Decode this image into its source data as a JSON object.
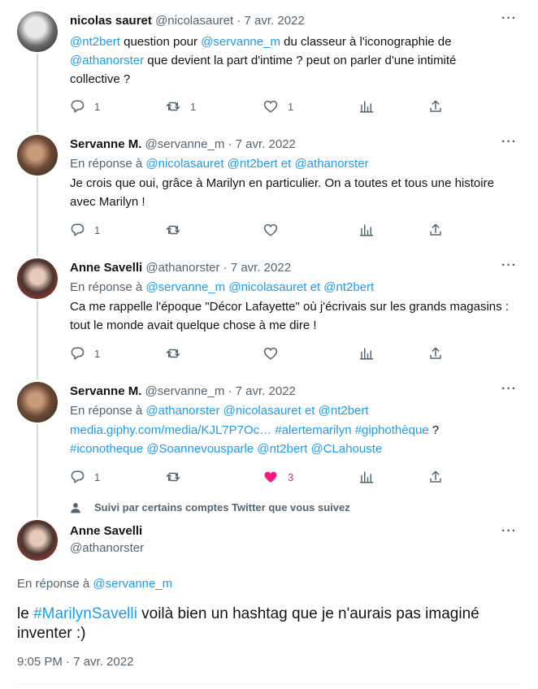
{
  "tweets": [
    {
      "name": "nicolas sauret",
      "handle": "@nicolasauret",
      "sep": "·",
      "date": "7 avr. 2022",
      "reply_prefix": "",
      "reply_handles": "",
      "text_parts": [
        {
          "t": "@nt2bert",
          "link": true
        },
        {
          "t": " question pour ",
          "link": false
        },
        {
          "t": "@servanne_m",
          "link": true
        },
        {
          "t": " du classeur à l'iconographie de ",
          "link": false
        },
        {
          "t": "@athanorster",
          "link": true
        },
        {
          "t": " que devient la part d'intime ? peut on parler d'une intimité collective ?",
          "link": false
        }
      ],
      "replies": "1",
      "retweets": "1",
      "likes": "1"
    },
    {
      "name": "Servanne M.",
      "handle": "@servanne_m",
      "sep": "·",
      "date": "7 avr. 2022",
      "reply_prefix": "En réponse à",
      "reply_handles": "@nicolasauret @nt2bert  et  @athanorster",
      "text_parts": [
        {
          "t": "Je crois que oui, grâce à Marilyn en particulier. On a toutes et tous une histoire avec Marilyn !",
          "link": false
        }
      ],
      "replies": "1",
      "retweets": "",
      "likes": ""
    },
    {
      "name": "Anne Savelli",
      "handle": "@athanorster",
      "sep": "·",
      "date": "7 avr. 2022",
      "reply_prefix": "En réponse à",
      "reply_handles": "@servanne_m @nicolasauret  et  @nt2bert",
      "text_parts": [
        {
          "t": "Ca me rappelle l'époque \"Décor Lafayette\" où j'écrivais sur les grands magasins : tout le monde avait quelque chose à me dire !",
          "link": false
        }
      ],
      "replies": "1",
      "retweets": "",
      "likes": ""
    },
    {
      "name": "Servanne M.",
      "handle": "@servanne_m",
      "sep": "·",
      "date": "7 avr. 2022",
      "reply_prefix": "En réponse à",
      "reply_handles": "@athanorster @nicolasauret  et  @nt2bert",
      "text_parts": [
        {
          "t": "media.giphy.com/media/KJL7P7Oc…",
          "link": true
        },
        {
          "t": "  ",
          "link": false
        },
        {
          "t": "#alertemarilyn #giphothèque",
          "link": true
        },
        {
          "t": " ? ",
          "link": false
        },
        {
          "t": "#iconotheque @Soannevousparle @nt2bert @CLahouste",
          "link": true
        }
      ],
      "replies": "1",
      "retweets": "",
      "likes": "3"
    }
  ],
  "social_context": "Suivi par certains comptes Twitter que vous suivez",
  "main": {
    "name": "Anne Savelli",
    "handle": "@athanorster",
    "reply_prefix": "En réponse à",
    "reply_handle": "@servanne_m",
    "text_before": "le ",
    "hashtag": "#MarilynSavelli",
    "text_after": " voilà bien un hashtag que je n'aurais pas imaginé inventer :)",
    "time": "9:05 PM · 7 avr. 2022"
  },
  "more_label": "···",
  "colors": {
    "accent": "#1d9bf0",
    "muted": "#536471",
    "like": "#f91880",
    "line": "#cfd9de"
  },
  "icons": [
    "reply-icon",
    "retweet-icon",
    "like-icon",
    "views-icon",
    "share-icon",
    "more-icon",
    "person-icon"
  ]
}
